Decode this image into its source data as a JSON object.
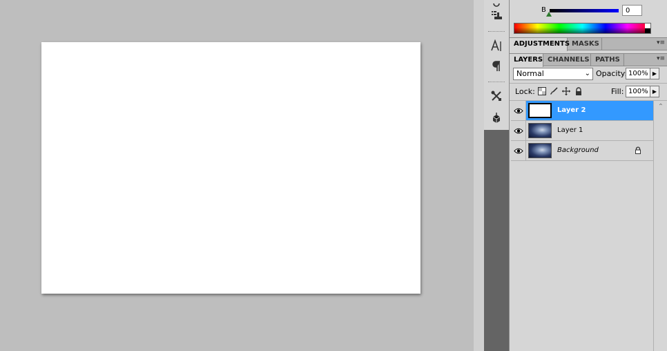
{
  "color_panel": {
    "channel_letter": "B",
    "channel_value": "0"
  },
  "panel_tabs_top": [
    {
      "label": "ADJUSTMENTS"
    },
    {
      "label": "MASKS"
    }
  ],
  "panel_tabs_layers": [
    {
      "label": "LAYERS"
    },
    {
      "label": "CHANNELS"
    },
    {
      "label": "PATHS"
    }
  ],
  "layers_controls": {
    "blend_mode": "Normal",
    "opacity_label": "Opacity:",
    "opacity_value": "100%",
    "lock_label": "Lock:",
    "fill_label": "Fill:",
    "fill_value": "100%"
  },
  "layers": [
    {
      "name": "Layer 2",
      "selected": true,
      "thumbnail": "white"
    },
    {
      "name": "Layer 1",
      "selected": false,
      "thumbnail": "photo"
    },
    {
      "name": "Background",
      "selected": false,
      "thumbnail": "photo",
      "locked": true
    }
  ],
  "icons": {
    "dock": [
      "clone-source-icon",
      "character-icon",
      "paragraph-icon",
      "tool-presets-icon",
      "3d-icon"
    ],
    "lock": [
      "lock-transparent-pixels-icon",
      "lock-image-pixels-icon",
      "lock-position-icon",
      "lock-all-icon"
    ]
  },
  "colors": {
    "selection": "#3399ff",
    "panel_bg": "#d6d6d6",
    "canvas_bg": "#bebebe",
    "dock_bg": "#646464"
  }
}
